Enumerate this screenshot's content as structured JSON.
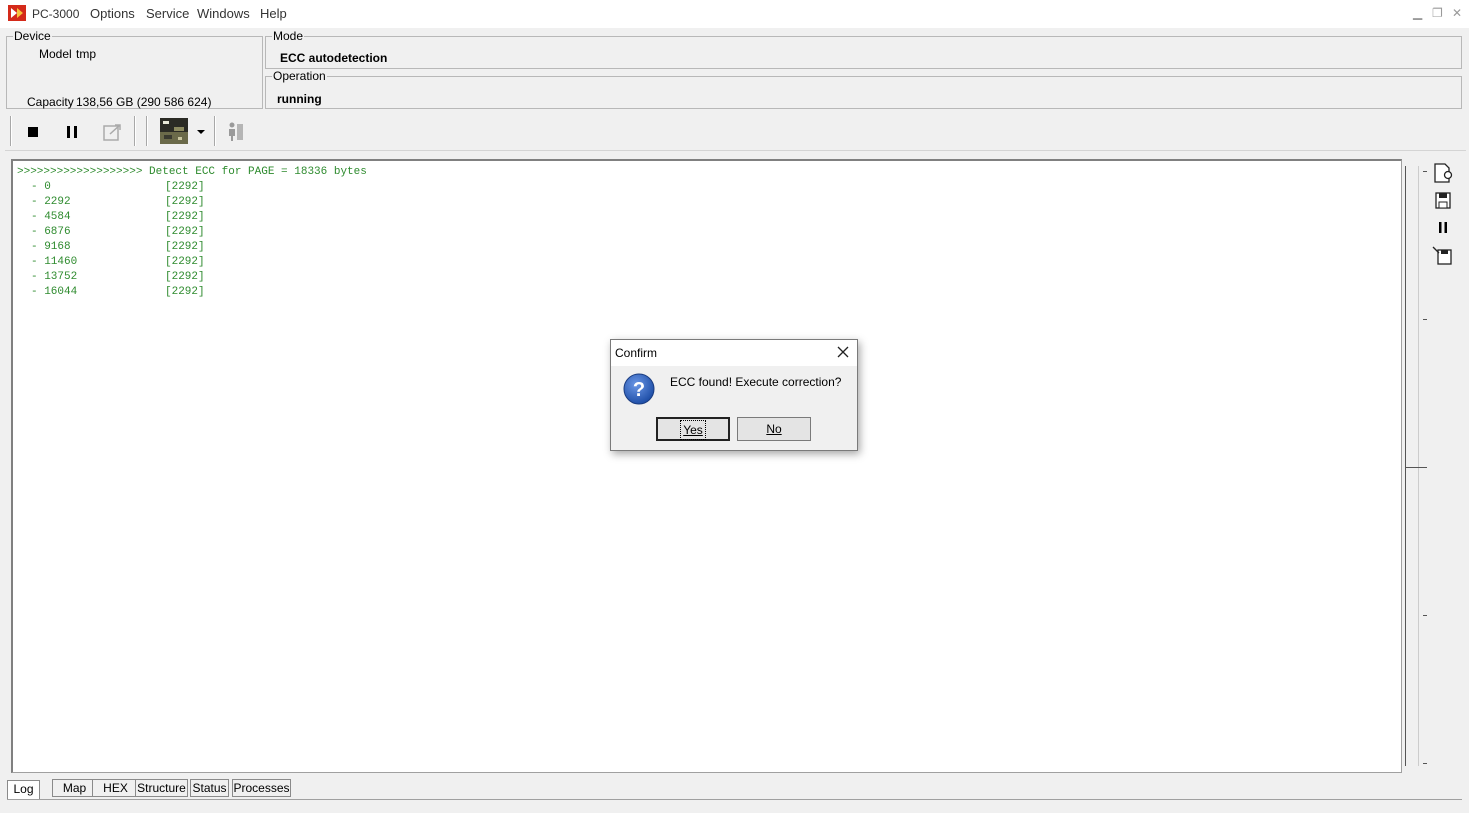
{
  "app": {
    "title": "PC-3000"
  },
  "menu": {
    "items": [
      "Options",
      "Service",
      "Windows",
      "Help"
    ]
  },
  "device": {
    "legend": "Device",
    "model_label": "Model",
    "model_value": "tmp",
    "capacity_label": "Capacity",
    "capacity_value": "138,56 GB (290 586 624)"
  },
  "mode": {
    "legend": "Mode",
    "value": "ECC autodetection"
  },
  "operation": {
    "legend": "Operation",
    "value": "running"
  },
  "toolbar": {
    "icons": [
      "stop-icon",
      "pause-icon",
      "export-icon",
      "image-preview-icon",
      "dropdown-arrow-icon",
      "person-icon"
    ]
  },
  "log": {
    "header": ">>>>>>>>>>>>>>>>>>> Detect ECC for PAGE = 18336 bytes",
    "rows": [
      {
        "offset": "- 0",
        "value": "[2292]"
      },
      {
        "offset": "- 2292",
        "value": "[2292]"
      },
      {
        "offset": "- 4584",
        "value": "[2292]"
      },
      {
        "offset": "- 6876",
        "value": "[2292]"
      },
      {
        "offset": "- 9168",
        "value": "[2292]"
      },
      {
        "offset": "- 11460",
        "value": "[2292]"
      },
      {
        "offset": "- 13752",
        "value": "[2292]"
      },
      {
        "offset": "- 16044",
        "value": "[2292]"
      }
    ]
  },
  "tabs": [
    "Log",
    "Map",
    "HEX",
    "Structure",
    "Status",
    "Processes"
  ],
  "active_tab": "Log",
  "dialog": {
    "title": "Confirm",
    "message": "ECC  found! Execute correction?",
    "yes_label": "Yes",
    "no_label": "No"
  },
  "colors": {
    "log_text": "#2e8b2e",
    "dialog_icon": "#1f4fa8"
  }
}
